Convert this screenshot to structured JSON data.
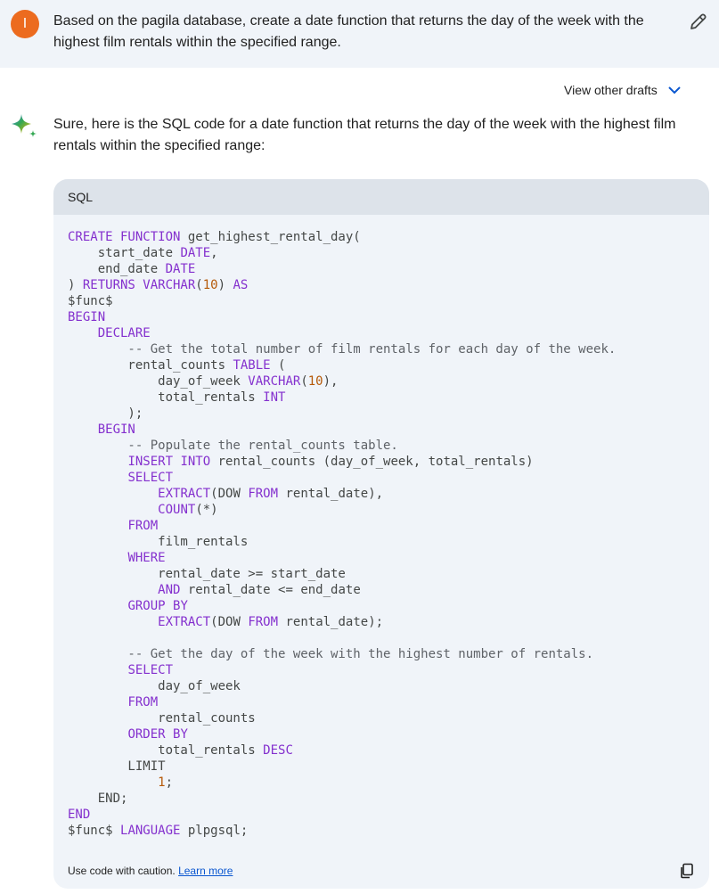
{
  "user_prompt": {
    "avatar_initial": "I",
    "text": "Based on the pagila database, create a date function that returns the day of the week with the highest film rentals within the specified range.",
    "edit_icon": "pencil-icon"
  },
  "response": {
    "view_drafts_label": "View other drafts",
    "drafts_icon": "chevron-down-icon",
    "model_icon": "sparkle-icon",
    "intro": "Sure, here is the SQL code for a date function that returns the day of the week with the highest film rentals within the specified range:",
    "code_block": {
      "language": "SQL",
      "lines": [
        [
          {
            "t": "CREATE FUNCTION ",
            "c": "kw"
          },
          {
            "t": "get_highest_rental_day(",
            "c": ""
          }
        ],
        [
          {
            "t": "    start_date ",
            "c": ""
          },
          {
            "t": "DATE",
            "c": "kw"
          },
          {
            "t": ",",
            "c": ""
          }
        ],
        [
          {
            "t": "    end_date ",
            "c": ""
          },
          {
            "t": "DATE",
            "c": "kw"
          }
        ],
        [
          {
            "t": ") ",
            "c": ""
          },
          {
            "t": "RETURNS VARCHAR",
            "c": "kw"
          },
          {
            "t": "(",
            "c": ""
          },
          {
            "t": "10",
            "c": "num"
          },
          {
            "t": ") ",
            "c": ""
          },
          {
            "t": "AS",
            "c": "kw"
          }
        ],
        [
          {
            "t": "$func$",
            "c": ""
          }
        ],
        [
          {
            "t": "BEGIN",
            "c": "kw"
          }
        ],
        [
          {
            "t": "    ",
            "c": ""
          },
          {
            "t": "DECLARE",
            "c": "kw"
          }
        ],
        [
          {
            "t": "        -- Get the total number of film rentals for each day of the week.",
            "c": "cm"
          }
        ],
        [
          {
            "t": "        rental_counts ",
            "c": ""
          },
          {
            "t": "TABLE",
            "c": "kw"
          },
          {
            "t": " (",
            "c": ""
          }
        ],
        [
          {
            "t": "            day_of_week ",
            "c": ""
          },
          {
            "t": "VARCHAR",
            "c": "kw"
          },
          {
            "t": "(",
            "c": ""
          },
          {
            "t": "10",
            "c": "num"
          },
          {
            "t": "),",
            "c": ""
          }
        ],
        [
          {
            "t": "            total_rentals ",
            "c": ""
          },
          {
            "t": "INT",
            "c": "kw"
          }
        ],
        [
          {
            "t": "        );",
            "c": ""
          }
        ],
        [
          {
            "t": "    ",
            "c": ""
          },
          {
            "t": "BEGIN",
            "c": "kw"
          }
        ],
        [
          {
            "t": "        -- Populate the rental_counts table.",
            "c": "cm"
          }
        ],
        [
          {
            "t": "        ",
            "c": ""
          },
          {
            "t": "INSERT INTO",
            "c": "kw"
          },
          {
            "t": " rental_counts (day_of_week, total_rentals)",
            "c": ""
          }
        ],
        [
          {
            "t": "        ",
            "c": ""
          },
          {
            "t": "SELECT",
            "c": "kw"
          }
        ],
        [
          {
            "t": "            ",
            "c": ""
          },
          {
            "t": "EXTRACT",
            "c": "kw"
          },
          {
            "t": "(DOW ",
            "c": ""
          },
          {
            "t": "FROM",
            "c": "kw"
          },
          {
            "t": " rental_date),",
            "c": ""
          }
        ],
        [
          {
            "t": "            ",
            "c": ""
          },
          {
            "t": "COUNT",
            "c": "kw"
          },
          {
            "t": "(*)",
            "c": ""
          }
        ],
        [
          {
            "t": "        ",
            "c": ""
          },
          {
            "t": "FROM",
            "c": "kw"
          }
        ],
        [
          {
            "t": "            film_rentals",
            "c": ""
          }
        ],
        [
          {
            "t": "        ",
            "c": ""
          },
          {
            "t": "WHERE",
            "c": "kw"
          }
        ],
        [
          {
            "t": "            rental_date >= start_date",
            "c": ""
          }
        ],
        [
          {
            "t": "            ",
            "c": ""
          },
          {
            "t": "AND",
            "c": "kw"
          },
          {
            "t": " rental_date <= end_date",
            "c": ""
          }
        ],
        [
          {
            "t": "        ",
            "c": ""
          },
          {
            "t": "GROUP BY",
            "c": "kw"
          }
        ],
        [
          {
            "t": "            ",
            "c": ""
          },
          {
            "t": "EXTRACT",
            "c": "kw"
          },
          {
            "t": "(DOW ",
            "c": ""
          },
          {
            "t": "FROM",
            "c": "kw"
          },
          {
            "t": " rental_date);",
            "c": ""
          }
        ],
        [
          {
            "t": "",
            "c": ""
          }
        ],
        [
          {
            "t": "        -- Get the day of the week with the highest number of rentals.",
            "c": "cm"
          }
        ],
        [
          {
            "t": "        ",
            "c": ""
          },
          {
            "t": "SELECT",
            "c": "kw"
          }
        ],
        [
          {
            "t": "            day_of_week",
            "c": ""
          }
        ],
        [
          {
            "t": "        ",
            "c": ""
          },
          {
            "t": "FROM",
            "c": "kw"
          }
        ],
        [
          {
            "t": "            rental_counts",
            "c": ""
          }
        ],
        [
          {
            "t": "        ",
            "c": ""
          },
          {
            "t": "ORDER BY",
            "c": "kw"
          }
        ],
        [
          {
            "t": "            total_rentals ",
            "c": ""
          },
          {
            "t": "DESC",
            "c": "kw"
          }
        ],
        [
          {
            "t": "        LIMIT",
            "c": ""
          }
        ],
        [
          {
            "t": "            ",
            "c": ""
          },
          {
            "t": "1",
            "c": "num"
          },
          {
            "t": ";",
            "c": ""
          }
        ],
        [
          {
            "t": "    END;",
            "c": ""
          }
        ],
        [
          {
            "t": "END",
            "c": "kw"
          }
        ],
        [
          {
            "t": "$func$ ",
            "c": ""
          },
          {
            "t": "LANGUAGE",
            "c": "kw"
          },
          {
            "t": " plpgsql;",
            "c": ""
          }
        ]
      ],
      "footer_caution": "Use code with caution.",
      "footer_link": "Learn more",
      "copy_icon": "copy-icon"
    }
  },
  "colors": {
    "user_bar_bg": "#f0f4f9",
    "avatar_bg": "#ec6b1f",
    "code_card_bg": "#f0f4f9",
    "code_header_bg": "#dde3ea",
    "keyword": "#8430ce",
    "number": "#b55908",
    "link": "#0b57d0"
  }
}
